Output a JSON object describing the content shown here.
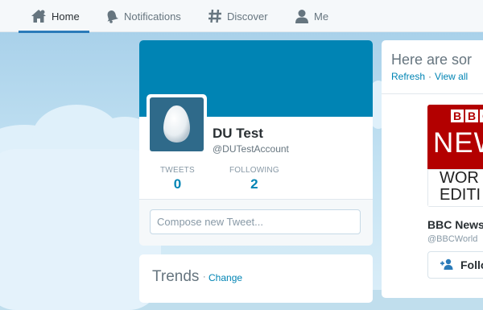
{
  "nav": {
    "items": [
      {
        "label": "Home",
        "icon": "home-icon",
        "active": true
      },
      {
        "label": "Notifications",
        "icon": "bell-icon"
      },
      {
        "label": "Discover",
        "icon": "hashtag-icon"
      },
      {
        "label": "Me",
        "icon": "person-icon"
      }
    ]
  },
  "profile": {
    "name": "DU Test",
    "handle": "@DUTestAccount",
    "stats": [
      {
        "label": "TWEETS",
        "value": "0"
      },
      {
        "label": "FOLLOWING",
        "value": "2"
      }
    ],
    "compose_placeholder": "Compose new Tweet..."
  },
  "trends": {
    "title": "Trends",
    "separator": "·",
    "change_label": "Change"
  },
  "who_to_follow": {
    "title": "Here are sor",
    "refresh_label": "Refresh",
    "separator": "·",
    "view_all_label": "View all",
    "suggestion": {
      "logo_text": {
        "letters": [
          "B",
          "B",
          "C"
        ],
        "news": "NEW",
        "world": "WOR",
        "edition": "EDITI"
      },
      "name": "BBC News",
      "handle": "@BBCWorld",
      "follow_label": "Follo"
    }
  },
  "colors": {
    "accent": "#0084b4",
    "banner": "#0084b4",
    "nav_active_underline": "#2b7bb9",
    "bbc_red": "#b30000"
  }
}
